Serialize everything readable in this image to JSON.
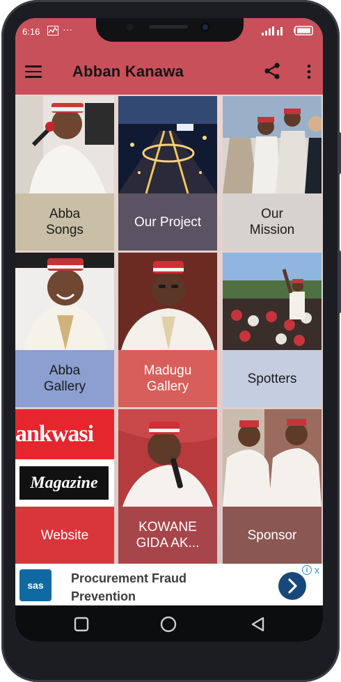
{
  "status_bar": {
    "time": "6:16"
  },
  "app_bar": {
    "title": "Abban Kanawa"
  },
  "tiles": [
    {
      "label_line1": "Abba",
      "label_line2": "Songs",
      "caption_color": "#c8bfa6",
      "text_dark": true
    },
    {
      "label_line1": "Our Project",
      "label_line2": "",
      "caption_color": "#5b5363",
      "text_dark": false
    },
    {
      "label_line1": "Our",
      "label_line2": "Mission",
      "caption_color": "#d7d2cf",
      "text_dark": true
    },
    {
      "label_line1": "Abba",
      "label_line2": "Gallery",
      "caption_color": "#8c9fd1",
      "text_dark": true
    },
    {
      "label_line1": "Madugu",
      "label_line2": "Gallery",
      "caption_color": "#d85e5a",
      "text_dark": false
    },
    {
      "label_line1": "Spotters",
      "label_line2": "",
      "caption_color": "#c5cde0",
      "text_dark": true
    },
    {
      "label_line1": "Website",
      "label_line2": "",
      "caption_color": "#d9363c",
      "text_dark": false
    },
    {
      "label_line1": "KOWANE",
      "label_line2": "GIDA AK...",
      "caption_color": "#a7464a",
      "text_dark": false
    },
    {
      "label_line1": "Sponsor",
      "label_line2": "",
      "caption_color": "#8b5753",
      "text_dark": false
    }
  ],
  "website_image": {
    "line1": "ankwasi",
    "line2": "Magazine"
  },
  "ad": {
    "logo": "sas",
    "headline_line1": "Procurement Fraud",
    "headline_line2": "Prevention",
    "info_glyph": "i",
    "close_glyph": "x"
  },
  "icons": [
    "menu-icon",
    "share-icon",
    "more-vert-icon",
    "chevron-right-icon",
    "square-nav-icon",
    "circle-nav-icon",
    "triangle-back-icon"
  ]
}
